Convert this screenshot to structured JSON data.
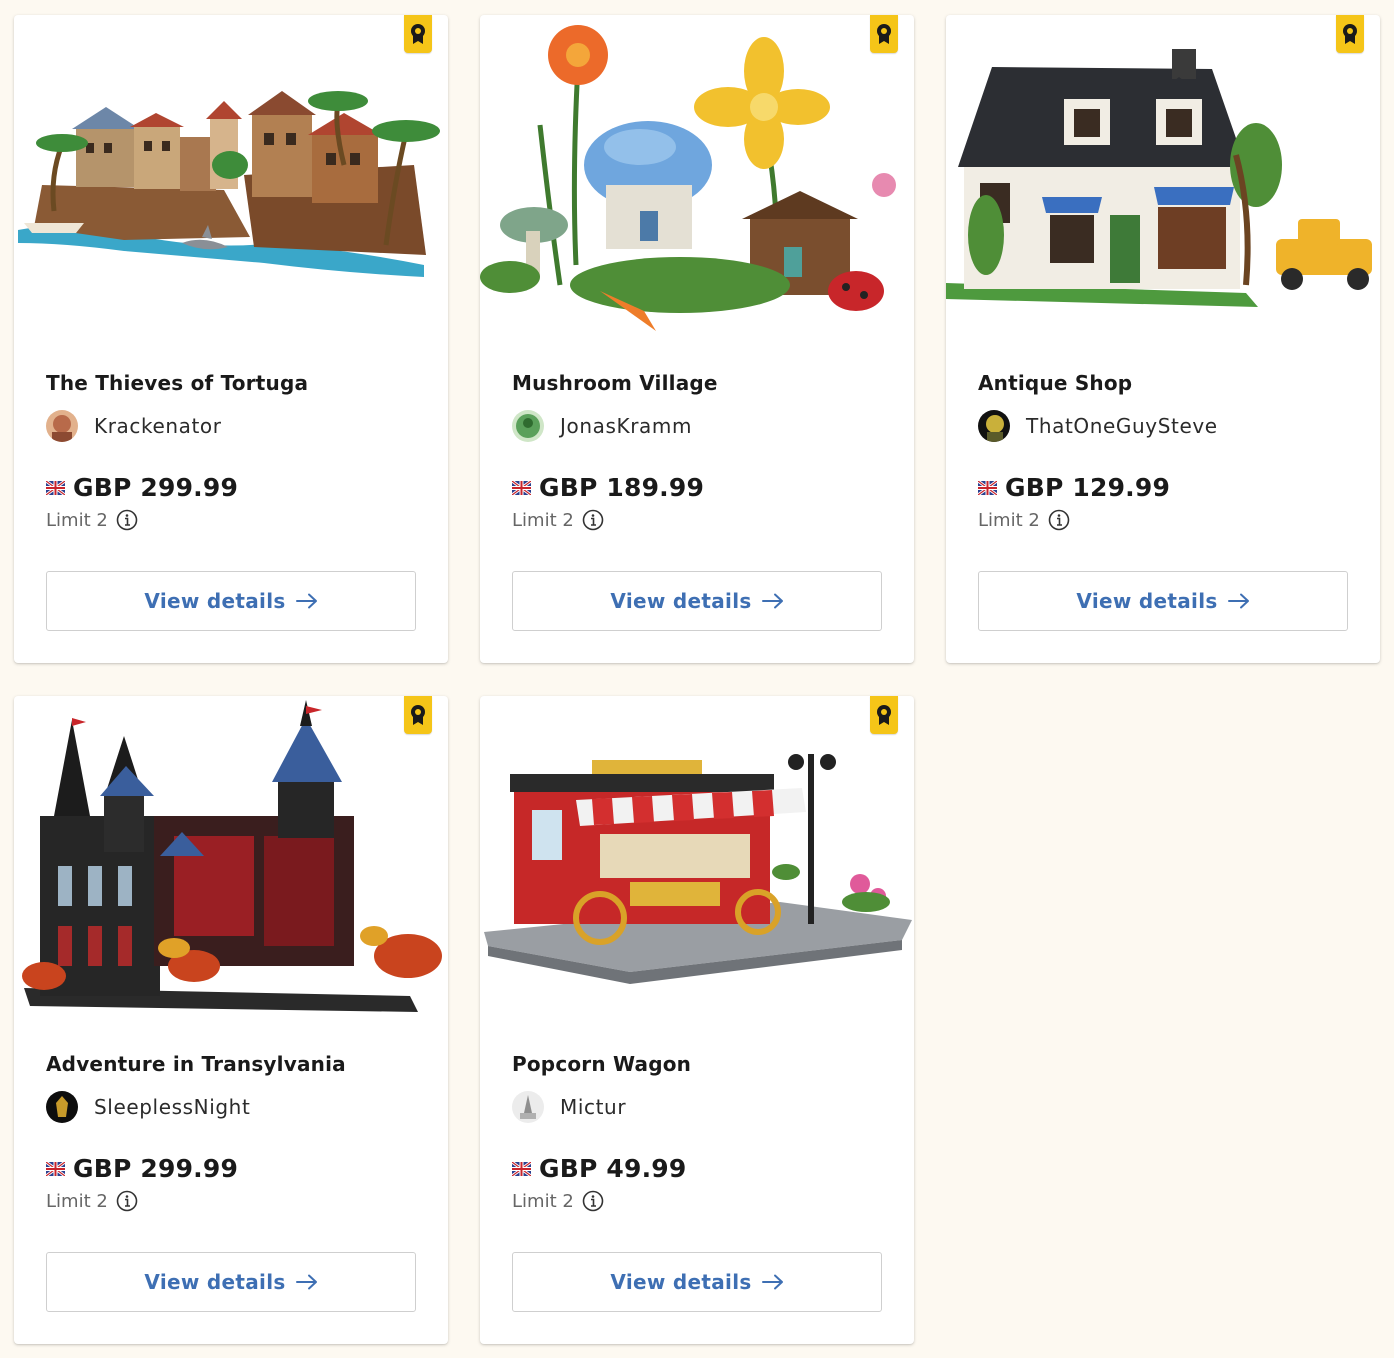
{
  "cards": [
    {
      "title": "The Thieves of Tortuga",
      "creator": "Krackenator",
      "price": "GBP 299.99",
      "limit": "Limit 2",
      "button_label": "View details",
      "badge_icon": "award-ribbon-icon",
      "flag_icon": "uk-flag-icon"
    },
    {
      "title": "Mushroom Village",
      "creator": "JonasKramm",
      "price": "GBP 189.99",
      "limit": "Limit 2",
      "button_label": "View details",
      "badge_icon": "award-ribbon-icon",
      "flag_icon": "uk-flag-icon"
    },
    {
      "title": "Antique Shop",
      "creator": "ThatOneGuySteve",
      "price": "GBP 129.99",
      "limit": "Limit 2",
      "button_label": "View details",
      "badge_icon": "award-ribbon-icon",
      "flag_icon": "uk-flag-icon"
    },
    {
      "title": "Adventure in Transylvania",
      "creator": "SleeplessNight",
      "price": "GBP 299.99",
      "limit": "Limit 2",
      "button_label": "View details",
      "badge_icon": "award-ribbon-icon",
      "flag_icon": "uk-flag-icon"
    },
    {
      "title": "Popcorn Wagon",
      "creator": "Mictur",
      "price": "GBP 49.99",
      "limit": "Limit 2",
      "button_label": "View details",
      "badge_icon": "award-ribbon-icon",
      "flag_icon": "uk-flag-icon"
    }
  ],
  "colors": {
    "page_background": "#fdf9f1",
    "badge": "#f5c518",
    "button_text": "#3e6fb3",
    "limit_text": "#666666"
  }
}
